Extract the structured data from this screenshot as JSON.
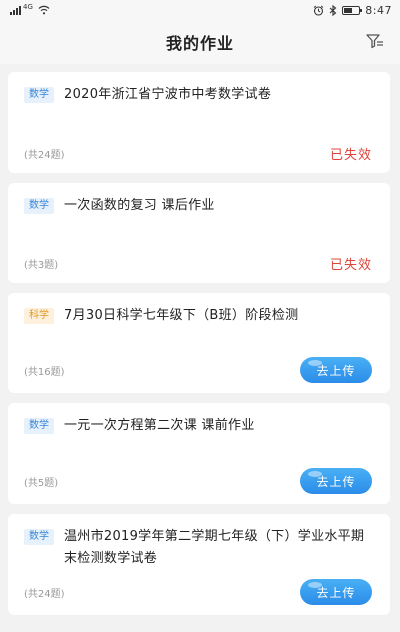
{
  "status_bar": {
    "signal_label": "4G",
    "time": "8:47"
  },
  "header": {
    "title": "我的作业"
  },
  "assignments": [
    {
      "subject": "数学",
      "subject_type": "math",
      "title": "2020年浙江省宁波市中考数学试卷",
      "count": "(共24题)",
      "status": "已失效",
      "action": ""
    },
    {
      "subject": "数学",
      "subject_type": "math",
      "title": "一次函数的复习 课后作业",
      "count": "(共3题)",
      "status": "已失效",
      "action": ""
    },
    {
      "subject": "科学",
      "subject_type": "science",
      "title": "7月30日科学七年级下（B班）阶段检测",
      "count": "(共16题)",
      "status": "",
      "action": "去上传"
    },
    {
      "subject": "数学",
      "subject_type": "math",
      "title": "一元一次方程第二次课 课前作业",
      "count": "(共5题)",
      "status": "",
      "action": "去上传"
    },
    {
      "subject": "数学",
      "subject_type": "math",
      "title": "温州市2019学年第二学期七年级（下）学业水平期末检测数学试卷",
      "count": "(共24题)",
      "status": "",
      "action": "去上传"
    }
  ],
  "colors": {
    "expired": "#e0443a",
    "upload_button": "#2a8ce8",
    "math_tag": "#3a87d8",
    "science_tag": "#e39a2a"
  },
  "icons": {
    "filter": "filter-icon",
    "wifi": "wifi-icon",
    "alarm": "alarm-icon",
    "bluetooth": "bluetooth-icon",
    "battery": "battery-icon"
  }
}
